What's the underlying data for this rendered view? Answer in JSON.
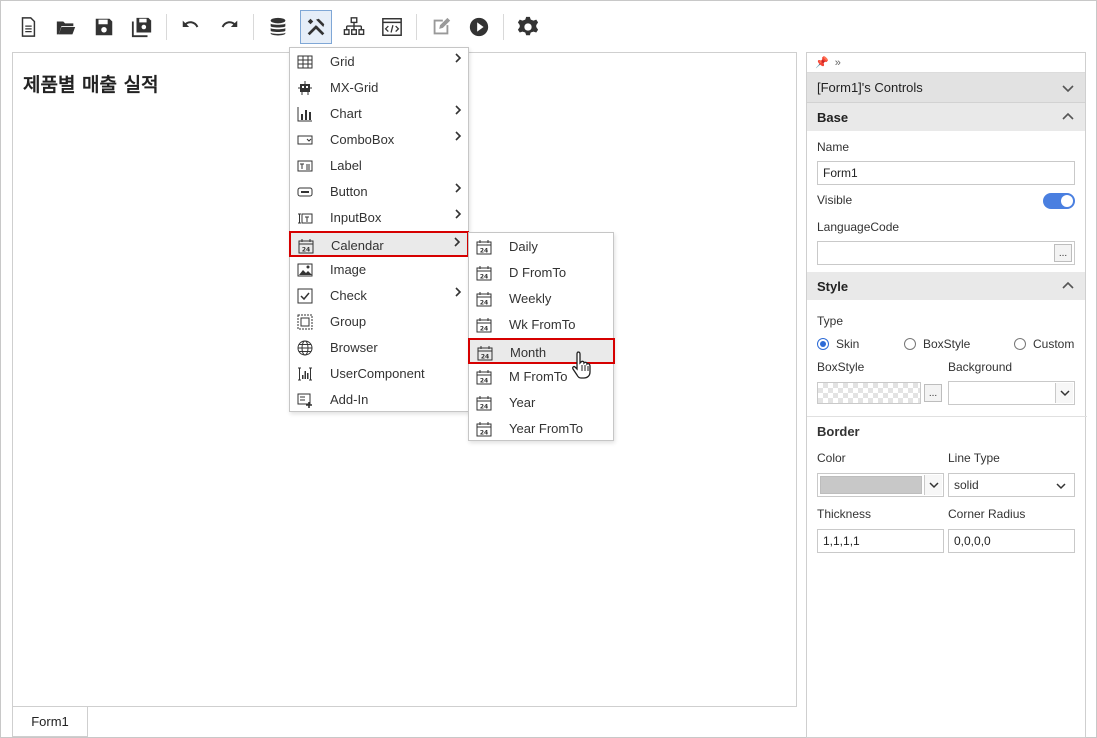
{
  "toolbar": {
    "buttons": [
      "new-document",
      "open-folder",
      "save",
      "save-all",
      "undo",
      "redo",
      "database",
      "tools",
      "hierarchy",
      "code-window",
      "edit",
      "run",
      "settings"
    ],
    "active": "tools"
  },
  "canvas": {
    "form_title": "제품별 매출 실적",
    "tab_label": "Form1"
  },
  "menu": {
    "items": [
      {
        "label": "Grid",
        "icon": "grid-icon",
        "has_submenu": true
      },
      {
        "label": "MX-Grid",
        "icon": "mx-grid-icon",
        "has_submenu": false
      },
      {
        "label": "Chart",
        "icon": "chart-icon",
        "has_submenu": true
      },
      {
        "label": "ComboBox",
        "icon": "combobox-icon",
        "has_submenu": true
      },
      {
        "label": "Label",
        "icon": "label-icon",
        "has_submenu": false
      },
      {
        "label": "Button",
        "icon": "button-icon",
        "has_submenu": true
      },
      {
        "label": "InputBox",
        "icon": "inputbox-icon",
        "has_submenu": true
      },
      {
        "label": "Calendar",
        "icon": "calendar-icon",
        "has_submenu": true,
        "highlighted": true
      },
      {
        "label": "Image",
        "icon": "image-icon",
        "has_submenu": false
      },
      {
        "label": "Check",
        "icon": "check-icon",
        "has_submenu": true
      },
      {
        "label": "Group",
        "icon": "group-icon",
        "has_submenu": false
      },
      {
        "label": "Browser",
        "icon": "globe-icon",
        "has_submenu": false
      },
      {
        "label": "UserComponent",
        "icon": "user-component-icon",
        "has_submenu": false
      },
      {
        "label": "Add-In",
        "icon": "add-in-icon",
        "has_submenu": false
      }
    ]
  },
  "submenu": {
    "items": [
      {
        "label": "Daily"
      },
      {
        "label": "D FromTo"
      },
      {
        "label": "Weekly"
      },
      {
        "label": "Wk FromTo"
      },
      {
        "label": "Month",
        "highlighted": true
      },
      {
        "label": "M FromTo"
      },
      {
        "label": "Year"
      },
      {
        "label": "Year FromTo"
      }
    ]
  },
  "panel": {
    "top_icons": "pin-icon expand-icon",
    "header": "[Form1]'s Controls",
    "base": {
      "title": "Base",
      "name_label": "Name",
      "name_value": "Form1",
      "visible_label": "Visible",
      "visible_on": true,
      "language_label": "LanguageCode",
      "language_value": "",
      "ellipsis": "..."
    },
    "style": {
      "title": "Style",
      "type_label": "Type",
      "types": [
        "Skin",
        "BoxStyle",
        "Custom"
      ],
      "type_selected": "Skin",
      "boxstyle_label": "BoxStyle",
      "background_label": "Background",
      "ellipsis": "..."
    },
    "border": {
      "title": "Border",
      "color_label": "Color",
      "color_value": "#c8c8c8",
      "linetype_label": "Line Type",
      "linetype_value": "solid",
      "thickness_label": "Thickness",
      "thickness_value": "1,1,1,1",
      "radius_label": "Corner Radius",
      "radius_value": "0,0,0,0"
    }
  },
  "colors": {
    "accent": "#4a7fe0",
    "highlight_border": "#d60000"
  }
}
